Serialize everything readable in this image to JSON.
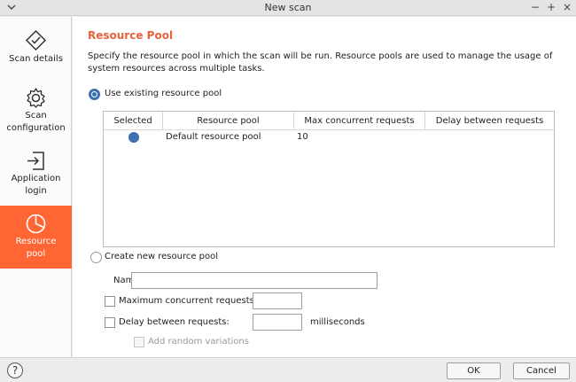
{
  "window": {
    "title": "New scan",
    "controls": [
      "⌄",
      "−",
      "+",
      "×"
    ]
  },
  "sidebar": {
    "items": [
      {
        "label": "Scan details",
        "icon": "scan-details-icon",
        "active": false
      },
      {
        "label": "Scan\nconfiguration",
        "icon": "gear-icon",
        "active": false
      },
      {
        "label": "Application\nlogin",
        "icon": "login-icon",
        "active": false
      },
      {
        "label": "Resource\npool",
        "icon": "pie-chart-icon",
        "active": true
      }
    ]
  },
  "content": {
    "section_title": "Resource Pool",
    "description": "Specify the resource pool in which the scan will be run. Resource pools are used to manage the usage of system resources across multiple tasks.",
    "use_existing_label": "Use existing resource pool",
    "table": {
      "headers": [
        "Selected",
        "Resource pool",
        "Max concurrent requests",
        "Delay between requests"
      ],
      "rows": [
        {
          "selected": true,
          "pool": "Default resource pool",
          "max": "10",
          "delay": ""
        }
      ]
    },
    "create_new_label": "Create new resource pool",
    "name_label": "Name:",
    "name_value": "",
    "max_concurrent_label": "Maximum concurrent requests:",
    "max_concurrent_value": "",
    "delay_label": "Delay between requests:",
    "delay_value": "",
    "delay_unit": "milliseconds",
    "random_variations_label": "Add random variations"
  },
  "footer": {
    "ok_label": "OK",
    "cancel_label": "Cancel",
    "help_label": "?"
  },
  "colors": {
    "accent": "#ff6633",
    "title_orange": "#e8623a",
    "radio_blue": "#3a6fb0"
  }
}
